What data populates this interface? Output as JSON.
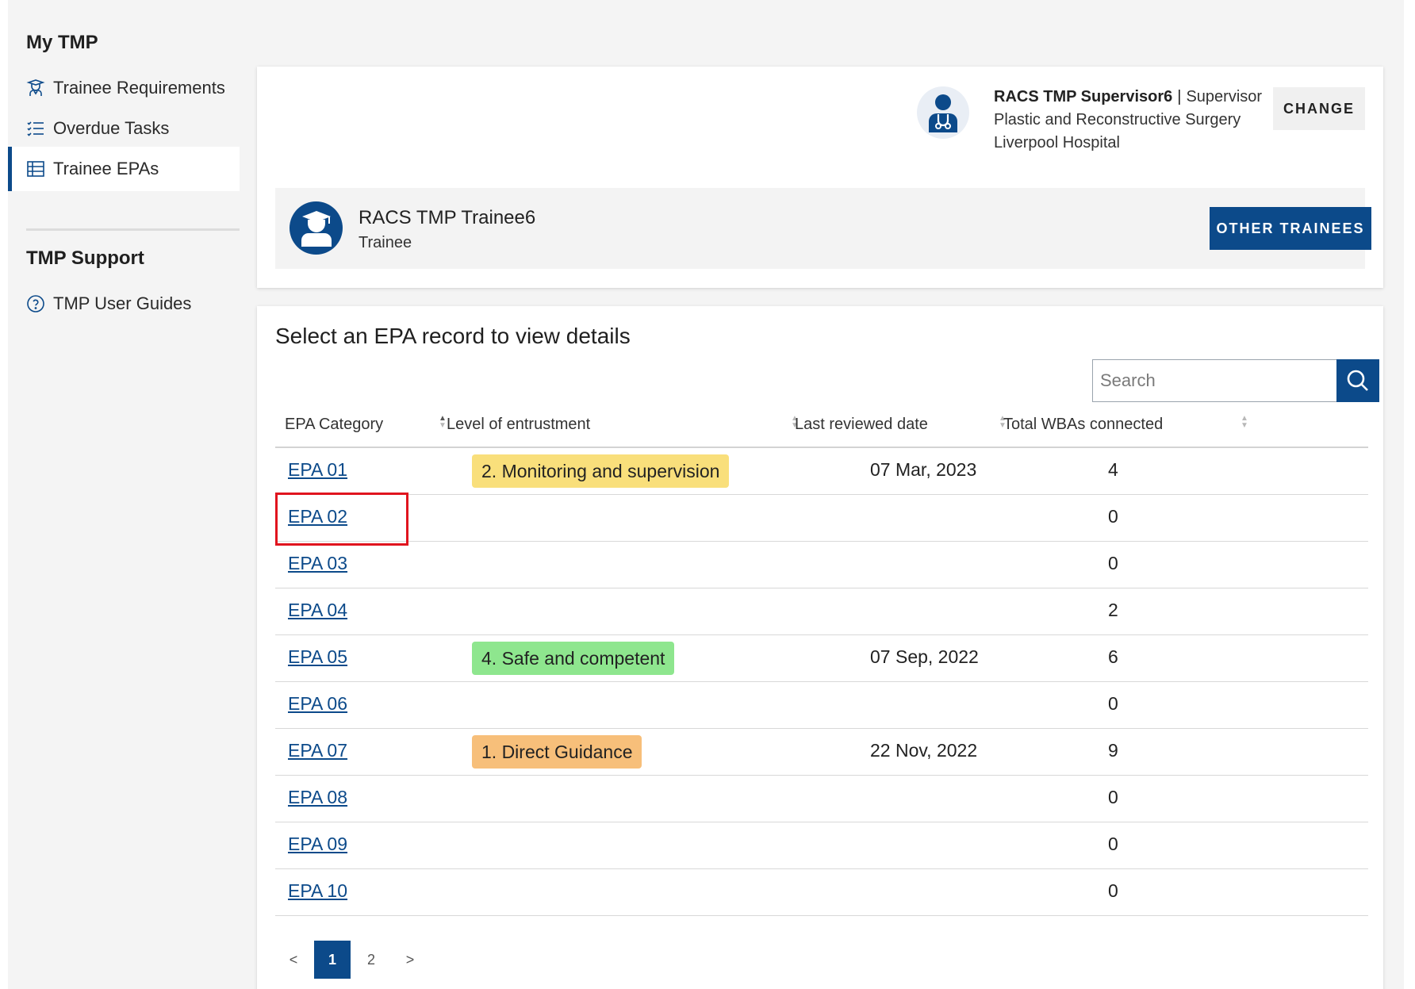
{
  "sidebar": {
    "my_tmp_heading": "My TMP",
    "items": [
      {
        "label": "Trainee Requirements",
        "icon": "graduate-icon"
      },
      {
        "label": "Overdue Tasks",
        "icon": "checklist-icon"
      },
      {
        "label": "Trainee EPAs",
        "icon": "table-icon",
        "active": true
      }
    ],
    "support_heading": "TMP Support",
    "support_items": [
      {
        "label": "TMP User Guides",
        "icon": "help-circle-icon"
      }
    ]
  },
  "supervisor": {
    "name": "RACS TMP Supervisor6",
    "separator": "|",
    "role": "Supervisor",
    "specialty": "Plastic and Reconstructive Surgery",
    "hospital": "Liverpool Hospital",
    "change_label": "CHANGE"
  },
  "trainee": {
    "name": "RACS TMP Trainee6",
    "role": "Trainee",
    "other_label": "OTHER TRAINEES"
  },
  "main": {
    "title": "Select an EPA record to view details",
    "search_placeholder": "Search"
  },
  "table": {
    "columns": [
      "EPA Category",
      "Level of entrustment",
      "Last reviewed date",
      "Total WBAs connected"
    ],
    "rows": [
      {
        "epa": "EPA 01",
        "level": "2. Monitoring and supervision",
        "level_color": "#f9df7b",
        "date": "07 Mar, 2023",
        "wbas": "4"
      },
      {
        "epa": "EPA 02",
        "level": "",
        "level_color": "",
        "date": "",
        "wbas": "0"
      },
      {
        "epa": "EPA 03",
        "level": "",
        "level_color": "",
        "date": "",
        "wbas": "0"
      },
      {
        "epa": "EPA 04",
        "level": "",
        "level_color": "",
        "date": "",
        "wbas": "2"
      },
      {
        "epa": "EPA 05",
        "level": "4. Safe and competent",
        "level_color": "#8ee68e",
        "date": "07 Sep, 2022",
        "wbas": "6"
      },
      {
        "epa": "EPA 06",
        "level": "",
        "level_color": "",
        "date": "",
        "wbas": "0"
      },
      {
        "epa": "EPA 07",
        "level": "1. Direct Guidance",
        "level_color": "#f7bf7a",
        "date": "22 Nov, 2022",
        "wbas": "9"
      },
      {
        "epa": "EPA 08",
        "level": "",
        "level_color": "",
        "date": "",
        "wbas": "0"
      },
      {
        "epa": "EPA 09",
        "level": "",
        "level_color": "",
        "date": "",
        "wbas": "0"
      },
      {
        "epa": "EPA 10",
        "level": "",
        "level_color": "",
        "date": "",
        "wbas": "0"
      }
    ]
  },
  "pagination": {
    "prev": "<",
    "pages": [
      "1",
      "2"
    ],
    "current": "1",
    "next": ">"
  },
  "colors": {
    "brand": "#0c4a8a",
    "highlight": "#e0141e"
  }
}
